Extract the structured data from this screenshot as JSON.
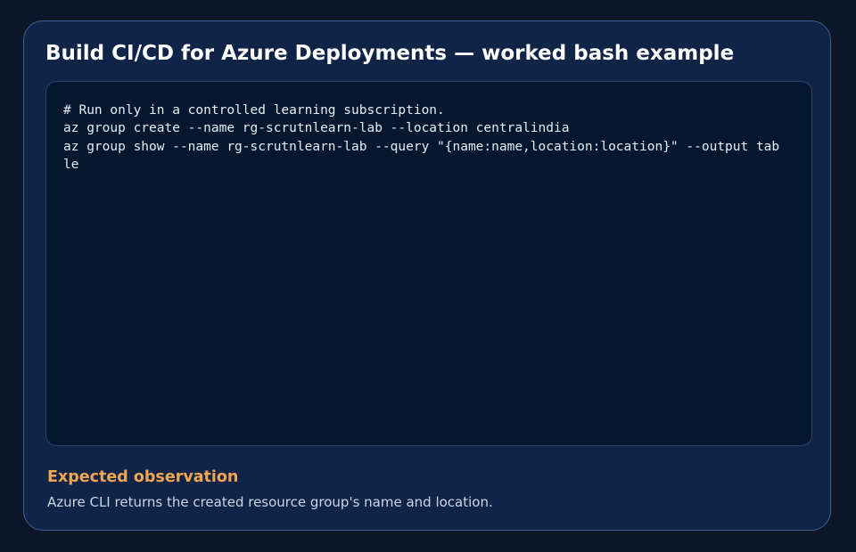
{
  "card": {
    "title": "Build CI/CD for Azure Deployments — worked bash example",
    "language": "bash",
    "code_lines": [
      "# Run only in a controlled learning subscription.",
      "az group create --name rg-scrutnlearn-lab --location centralindia",
      "az group show --name rg-scrutnlearn-lab --query \"{name:name,location:location}\" --output tab",
      "le"
    ],
    "observation": {
      "heading": "Expected observation",
      "text": "Azure CLI returns the created resource group's name and location."
    }
  },
  "colors": {
    "background": "#0b1628",
    "card_background": "#0f2447",
    "card_border": "#3f5f8f",
    "code_background": "#03172e",
    "title_text": "#ffffff",
    "code_text": "#e6edf7",
    "observation_heading": "#f2a652",
    "observation_text": "#c9d6e8"
  }
}
